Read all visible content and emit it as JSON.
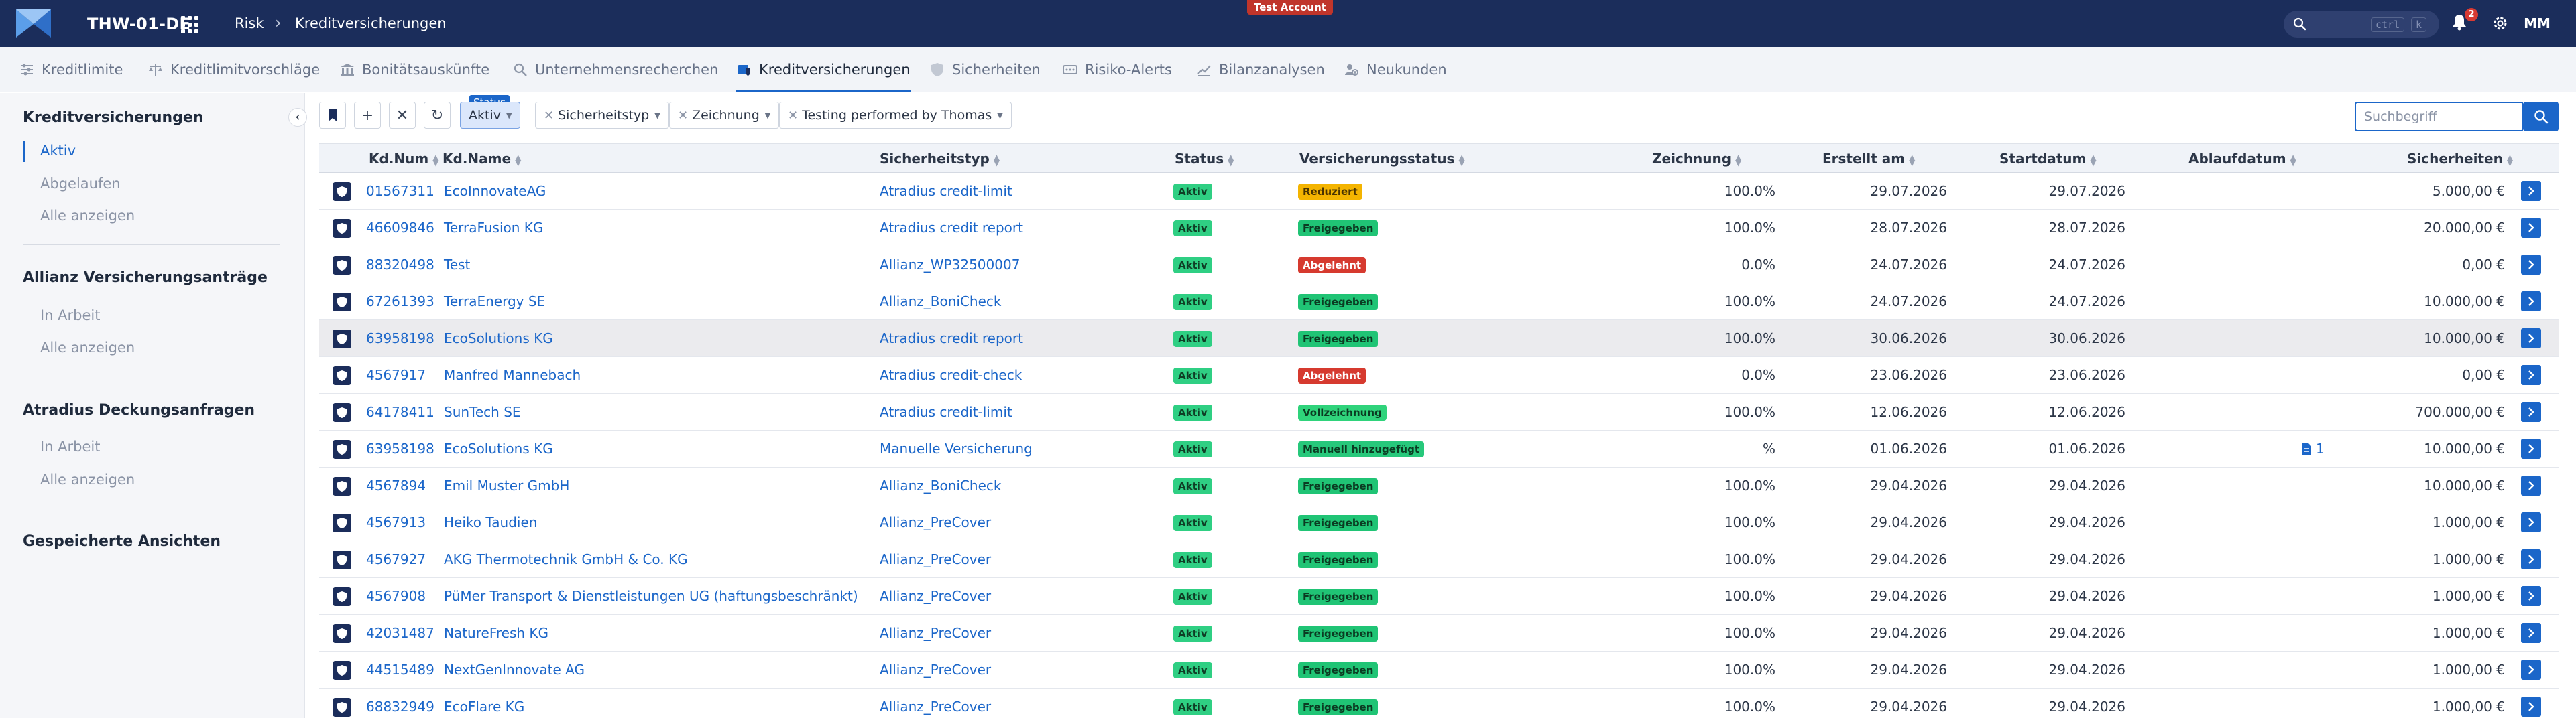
{
  "header": {
    "app_title": "THW-01-DE",
    "breadcrumb_root": "Risk",
    "breadcrumb_current": "Kreditversicherungen",
    "test_badge": "Test Account",
    "search_kbd_1": "ctrl",
    "search_kbd_2": "k",
    "notification_count": "2",
    "avatar": "MM"
  },
  "tabs": [
    {
      "label": "Kreditlimite",
      "icon": "sliders-icon"
    },
    {
      "label": "Kreditlimitvorschläge",
      "icon": "scale-icon"
    },
    {
      "label": "Bonitätsauskünfte",
      "icon": "bank-icon"
    },
    {
      "label": "Unternehmensrecherchen",
      "icon": "search-icon"
    },
    {
      "label": "Kreditversicherungen",
      "icon": "policy-icon",
      "active": true
    },
    {
      "label": "Sicherheiten",
      "icon": "shield-icon"
    },
    {
      "label": "Risiko-Alerts",
      "icon": "alert-icon"
    },
    {
      "label": "Bilanzanalysen",
      "icon": "chart-icon"
    },
    {
      "label": "Neukunden",
      "icon": "users-icon"
    }
  ],
  "sidebar": {
    "sections": [
      {
        "title": "Kreditversicherungen",
        "items": [
          "Aktiv",
          "Abgelaufen",
          "Alle anzeigen"
        ]
      },
      {
        "title": "Allianz Versicherungsanträge",
        "items": [
          "In Arbeit",
          "Alle anzeigen"
        ]
      },
      {
        "title": "Atradius Deckungsanfragen",
        "items": [
          "In Arbeit",
          "Alle anzeigen"
        ]
      },
      {
        "title": "Gespeicherte Ansichten",
        "items": []
      }
    ],
    "active_item": "Aktiv"
  },
  "toolbar": {
    "status_tag": "Status",
    "filters": {
      "status": "Aktiv",
      "sicherheitstyp": "Sicherheitstyp",
      "zeichnung": "Zeichnung",
      "testing": "Testing performed by Thomas"
    },
    "search_placeholder": "Suchbegriff"
  },
  "table": {
    "columns": {
      "kdnum": "Kd.Num",
      "kdname": "Kd.Name",
      "sicherheitstyp": "Sicherheitstyp",
      "status": "Status",
      "versicherungsstatus": "Versicherungsstatus",
      "zeichnung": "Zeichnung",
      "erstellt": "Erstellt am",
      "startdatum": "Startdatum",
      "ablaufdatum": "Ablaufdatum",
      "sicherheiten": "Sicherheiten"
    },
    "rows": [
      {
        "kdnum": "01567311",
        "kdname": "EcoInnovateAG",
        "typ": "Atradius credit-limit",
        "status": "Aktiv",
        "vstatus": "Reduziert",
        "vstatus_kind": "reduziert",
        "zeichnung": "100.0%",
        "erstellt": "29.07.2026",
        "start": "29.07.2026",
        "ablauf": "",
        "sicherheiten": "5.000,00 €"
      },
      {
        "kdnum": "46609846",
        "kdname": "TerraFusion KG",
        "typ": "Atradius credit report",
        "status": "Aktiv",
        "vstatus": "Freigegeben",
        "vstatus_kind": "freigegeben",
        "zeichnung": "100.0%",
        "erstellt": "28.07.2026",
        "start": "28.07.2026",
        "ablauf": "",
        "sicherheiten": "20.000,00 €"
      },
      {
        "kdnum": "88320498",
        "kdname": "Test",
        "typ": "Allianz_WP32500007",
        "status": "Aktiv",
        "vstatus": "Abgelehnt",
        "vstatus_kind": "abgelehnt",
        "zeichnung": "0.0%",
        "erstellt": "24.07.2026",
        "start": "24.07.2026",
        "ablauf": "",
        "sicherheiten": "0,00 €"
      },
      {
        "kdnum": "67261393",
        "kdname": "TerraEnergy SE",
        "typ": "Allianz_BoniCheck",
        "status": "Aktiv",
        "vstatus": "Freigegeben",
        "vstatus_kind": "freigegeben",
        "zeichnung": "100.0%",
        "erstellt": "24.07.2026",
        "start": "24.07.2026",
        "ablauf": "",
        "sicherheiten": "10.000,00 €"
      },
      {
        "kdnum": "63958198",
        "kdname": "EcoSolutions KG",
        "typ": "Atradius credit report",
        "status": "Aktiv",
        "vstatus": "Freigegeben",
        "vstatus_kind": "freigegeben",
        "zeichnung": "100.0%",
        "erstellt": "30.06.2026",
        "start": "30.06.2026",
        "ablauf": "",
        "sicherheiten": "10.000,00 €",
        "hover": true
      },
      {
        "kdnum": "4567917",
        "kdname": "Manfred Mannebach",
        "typ": "Atradius credit-check",
        "status": "Aktiv",
        "vstatus": "Abgelehnt",
        "vstatus_kind": "abgelehnt",
        "zeichnung": "0.0%",
        "erstellt": "23.06.2026",
        "start": "23.06.2026",
        "ablauf": "",
        "sicherheiten": "0,00 €"
      },
      {
        "kdnum": "64178411",
        "kdname": "SunTech SE",
        "typ": "Atradius credit-limit",
        "status": "Aktiv",
        "vstatus": "Vollzeichnung",
        "vstatus_kind": "voll",
        "zeichnung": "100.0%",
        "erstellt": "12.06.2026",
        "start": "12.06.2026",
        "ablauf": "",
        "sicherheiten": "700.000,00 €"
      },
      {
        "kdnum": "63958198",
        "kdname": "EcoSolutions KG",
        "typ": "Manuelle Versicherung",
        "status": "Aktiv",
        "vstatus": "Manuell hinzugefügt",
        "vstatus_kind": "manuell",
        "zeichnung": "%",
        "erstellt": "01.06.2026",
        "start": "01.06.2026",
        "ablauf": "",
        "doc_count": "1",
        "sicherheiten": "10.000,00 €"
      },
      {
        "kdnum": "4567894",
        "kdname": "Emil Muster GmbH",
        "typ": "Allianz_BoniCheck",
        "status": "Aktiv",
        "vstatus": "Freigegeben",
        "vstatus_kind": "freigegeben",
        "zeichnung": "100.0%",
        "erstellt": "29.04.2026",
        "start": "29.04.2026",
        "ablauf": "",
        "sicherheiten": "10.000,00 €"
      },
      {
        "kdnum": "4567913",
        "kdname": "Heiko Taudien",
        "typ": "Allianz_PreCover",
        "status": "Aktiv",
        "vstatus": "Freigegeben",
        "vstatus_kind": "freigegeben",
        "zeichnung": "100.0%",
        "erstellt": "29.04.2026",
        "start": "29.04.2026",
        "ablauf": "",
        "sicherheiten": "1.000,00 €"
      },
      {
        "kdnum": "4567927",
        "kdname": "AKG Thermotechnik GmbH & Co. KG",
        "typ": "Allianz_PreCover",
        "status": "Aktiv",
        "vstatus": "Freigegeben",
        "vstatus_kind": "freigegeben",
        "zeichnung": "100.0%",
        "erstellt": "29.04.2026",
        "start": "29.04.2026",
        "ablauf": "",
        "sicherheiten": "1.000,00 €"
      },
      {
        "kdnum": "4567908",
        "kdname": "PüMer Transport & Dienstleistungen UG (haftungsbeschränkt)",
        "typ": "Allianz_PreCover",
        "status": "Aktiv",
        "vstatus": "Freigegeben",
        "vstatus_kind": "freigegeben",
        "zeichnung": "100.0%",
        "erstellt": "29.04.2026",
        "start": "29.04.2026",
        "ablauf": "",
        "sicherheiten": "1.000,00 €"
      },
      {
        "kdnum": "42031487",
        "kdname": "NatureFresh KG",
        "typ": "Allianz_PreCover",
        "status": "Aktiv",
        "vstatus": "Freigegeben",
        "vstatus_kind": "freigegeben",
        "zeichnung": "100.0%",
        "erstellt": "29.04.2026",
        "start": "29.04.2026",
        "ablauf": "",
        "sicherheiten": "1.000,00 €"
      },
      {
        "kdnum": "44515489",
        "kdname": "NextGenInnovate AG",
        "typ": "Allianz_PreCover",
        "status": "Aktiv",
        "vstatus": "Freigegeben",
        "vstatus_kind": "freigegeben",
        "zeichnung": "100.0%",
        "erstellt": "29.04.2026",
        "start": "29.04.2026",
        "ablauf": "",
        "sicherheiten": "1.000,00 €"
      },
      {
        "kdnum": "68832949",
        "kdname": "EcoFlare KG",
        "typ": "Allianz_PreCover",
        "status": "Aktiv",
        "vstatus": "Freigegeben",
        "vstatus_kind": "freigegeben",
        "zeichnung": "100.0%",
        "erstellt": "29.04.2026",
        "start": "29.04.2026",
        "ablauf": "",
        "sicherheiten": "1.000,00 €"
      }
    ]
  },
  "colors": {
    "header_bg": "#1b2d5b",
    "accent": "#1b66c9",
    "aktiv": "#2fcf83",
    "reduziert": "#f4b400",
    "abgelehnt": "#d63a2f"
  }
}
